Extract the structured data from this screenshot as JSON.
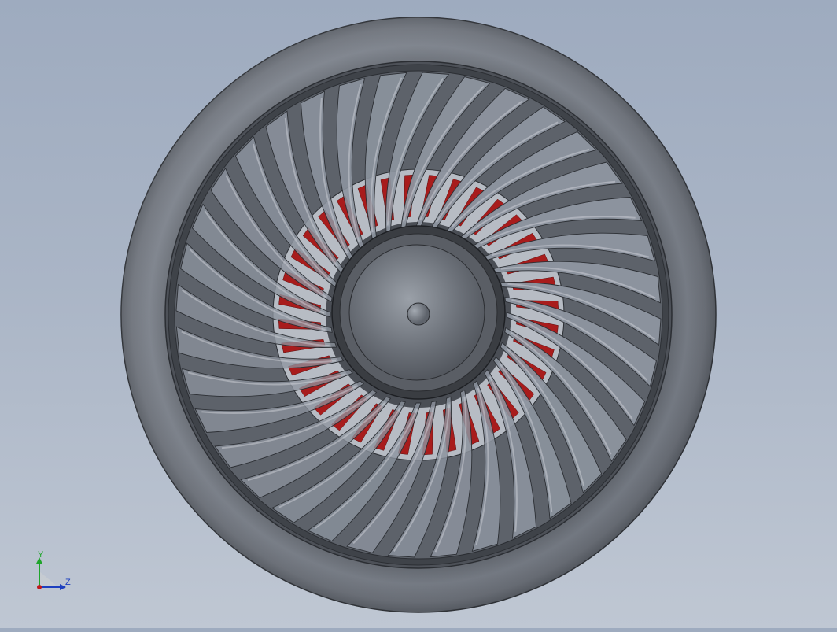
{
  "viewport": {
    "background_top": "#9eabbf",
    "background_bottom": "#bfc7d3",
    "view": "front"
  },
  "model": {
    "type": "turbofan-fan-assembly",
    "blade_count": 36,
    "colors": {
      "nacelle": "#70757e",
      "blade": "#8c939e",
      "spinner": "#6e737b",
      "core_accent": "#a81c1c"
    }
  },
  "triad": {
    "y_label": "Y",
    "z_label": "Z",
    "y_color": "#1fa52b",
    "z_color": "#1d3fbf",
    "origin_color": "#c0181e"
  }
}
